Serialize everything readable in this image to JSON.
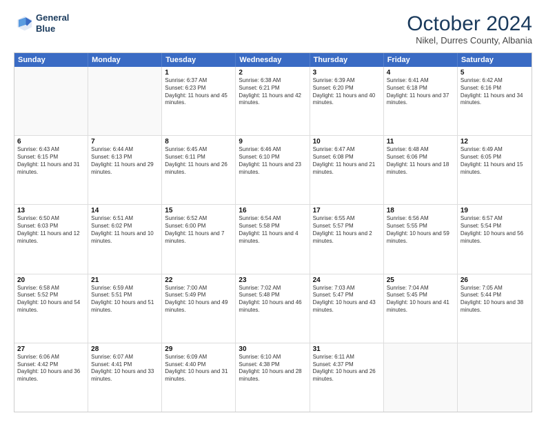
{
  "header": {
    "logo_line1": "General",
    "logo_line2": "Blue",
    "month": "October 2024",
    "location": "Nikel, Durres County, Albania"
  },
  "days_of_week": [
    "Sunday",
    "Monday",
    "Tuesday",
    "Wednesday",
    "Thursday",
    "Friday",
    "Saturday"
  ],
  "weeks": [
    [
      {
        "day": "",
        "sunrise": "",
        "sunset": "",
        "daylight": ""
      },
      {
        "day": "",
        "sunrise": "",
        "sunset": "",
        "daylight": ""
      },
      {
        "day": "1",
        "sunrise": "Sunrise: 6:37 AM",
        "sunset": "Sunset: 6:23 PM",
        "daylight": "Daylight: 11 hours and 45 minutes."
      },
      {
        "day": "2",
        "sunrise": "Sunrise: 6:38 AM",
        "sunset": "Sunset: 6:21 PM",
        "daylight": "Daylight: 11 hours and 42 minutes."
      },
      {
        "day": "3",
        "sunrise": "Sunrise: 6:39 AM",
        "sunset": "Sunset: 6:20 PM",
        "daylight": "Daylight: 11 hours and 40 minutes."
      },
      {
        "day": "4",
        "sunrise": "Sunrise: 6:41 AM",
        "sunset": "Sunset: 6:18 PM",
        "daylight": "Daylight: 11 hours and 37 minutes."
      },
      {
        "day": "5",
        "sunrise": "Sunrise: 6:42 AM",
        "sunset": "Sunset: 6:16 PM",
        "daylight": "Daylight: 11 hours and 34 minutes."
      }
    ],
    [
      {
        "day": "6",
        "sunrise": "Sunrise: 6:43 AM",
        "sunset": "Sunset: 6:15 PM",
        "daylight": "Daylight: 11 hours and 31 minutes."
      },
      {
        "day": "7",
        "sunrise": "Sunrise: 6:44 AM",
        "sunset": "Sunset: 6:13 PM",
        "daylight": "Daylight: 11 hours and 29 minutes."
      },
      {
        "day": "8",
        "sunrise": "Sunrise: 6:45 AM",
        "sunset": "Sunset: 6:11 PM",
        "daylight": "Daylight: 11 hours and 26 minutes."
      },
      {
        "day": "9",
        "sunrise": "Sunrise: 6:46 AM",
        "sunset": "Sunset: 6:10 PM",
        "daylight": "Daylight: 11 hours and 23 minutes."
      },
      {
        "day": "10",
        "sunrise": "Sunrise: 6:47 AM",
        "sunset": "Sunset: 6:08 PM",
        "daylight": "Daylight: 11 hours and 21 minutes."
      },
      {
        "day": "11",
        "sunrise": "Sunrise: 6:48 AM",
        "sunset": "Sunset: 6:06 PM",
        "daylight": "Daylight: 11 hours and 18 minutes."
      },
      {
        "day": "12",
        "sunrise": "Sunrise: 6:49 AM",
        "sunset": "Sunset: 6:05 PM",
        "daylight": "Daylight: 11 hours and 15 minutes."
      }
    ],
    [
      {
        "day": "13",
        "sunrise": "Sunrise: 6:50 AM",
        "sunset": "Sunset: 6:03 PM",
        "daylight": "Daylight: 11 hours and 12 minutes."
      },
      {
        "day": "14",
        "sunrise": "Sunrise: 6:51 AM",
        "sunset": "Sunset: 6:02 PM",
        "daylight": "Daylight: 11 hours and 10 minutes."
      },
      {
        "day": "15",
        "sunrise": "Sunrise: 6:52 AM",
        "sunset": "Sunset: 6:00 PM",
        "daylight": "Daylight: 11 hours and 7 minutes."
      },
      {
        "day": "16",
        "sunrise": "Sunrise: 6:54 AM",
        "sunset": "Sunset: 5:58 PM",
        "daylight": "Daylight: 11 hours and 4 minutes."
      },
      {
        "day": "17",
        "sunrise": "Sunrise: 6:55 AM",
        "sunset": "Sunset: 5:57 PM",
        "daylight": "Daylight: 11 hours and 2 minutes."
      },
      {
        "day": "18",
        "sunrise": "Sunrise: 6:56 AM",
        "sunset": "Sunset: 5:55 PM",
        "daylight": "Daylight: 10 hours and 59 minutes."
      },
      {
        "day": "19",
        "sunrise": "Sunrise: 6:57 AM",
        "sunset": "Sunset: 5:54 PM",
        "daylight": "Daylight: 10 hours and 56 minutes."
      }
    ],
    [
      {
        "day": "20",
        "sunrise": "Sunrise: 6:58 AM",
        "sunset": "Sunset: 5:52 PM",
        "daylight": "Daylight: 10 hours and 54 minutes."
      },
      {
        "day": "21",
        "sunrise": "Sunrise: 6:59 AM",
        "sunset": "Sunset: 5:51 PM",
        "daylight": "Daylight: 10 hours and 51 minutes."
      },
      {
        "day": "22",
        "sunrise": "Sunrise: 7:00 AM",
        "sunset": "Sunset: 5:49 PM",
        "daylight": "Daylight: 10 hours and 49 minutes."
      },
      {
        "day": "23",
        "sunrise": "Sunrise: 7:02 AM",
        "sunset": "Sunset: 5:48 PM",
        "daylight": "Daylight: 10 hours and 46 minutes."
      },
      {
        "day": "24",
        "sunrise": "Sunrise: 7:03 AM",
        "sunset": "Sunset: 5:47 PM",
        "daylight": "Daylight: 10 hours and 43 minutes."
      },
      {
        "day": "25",
        "sunrise": "Sunrise: 7:04 AM",
        "sunset": "Sunset: 5:45 PM",
        "daylight": "Daylight: 10 hours and 41 minutes."
      },
      {
        "day": "26",
        "sunrise": "Sunrise: 7:05 AM",
        "sunset": "Sunset: 5:44 PM",
        "daylight": "Daylight: 10 hours and 38 minutes."
      }
    ],
    [
      {
        "day": "27",
        "sunrise": "Sunrise: 6:06 AM",
        "sunset": "Sunset: 4:42 PM",
        "daylight": "Daylight: 10 hours and 36 minutes."
      },
      {
        "day": "28",
        "sunrise": "Sunrise: 6:07 AM",
        "sunset": "Sunset: 4:41 PM",
        "daylight": "Daylight: 10 hours and 33 minutes."
      },
      {
        "day": "29",
        "sunrise": "Sunrise: 6:09 AM",
        "sunset": "Sunset: 4:40 PM",
        "daylight": "Daylight: 10 hours and 31 minutes."
      },
      {
        "day": "30",
        "sunrise": "Sunrise: 6:10 AM",
        "sunset": "Sunset: 4:38 PM",
        "daylight": "Daylight: 10 hours and 28 minutes."
      },
      {
        "day": "31",
        "sunrise": "Sunrise: 6:11 AM",
        "sunset": "Sunset: 4:37 PM",
        "daylight": "Daylight: 10 hours and 26 minutes."
      },
      {
        "day": "",
        "sunrise": "",
        "sunset": "",
        "daylight": ""
      },
      {
        "day": "",
        "sunrise": "",
        "sunset": "",
        "daylight": ""
      }
    ]
  ]
}
